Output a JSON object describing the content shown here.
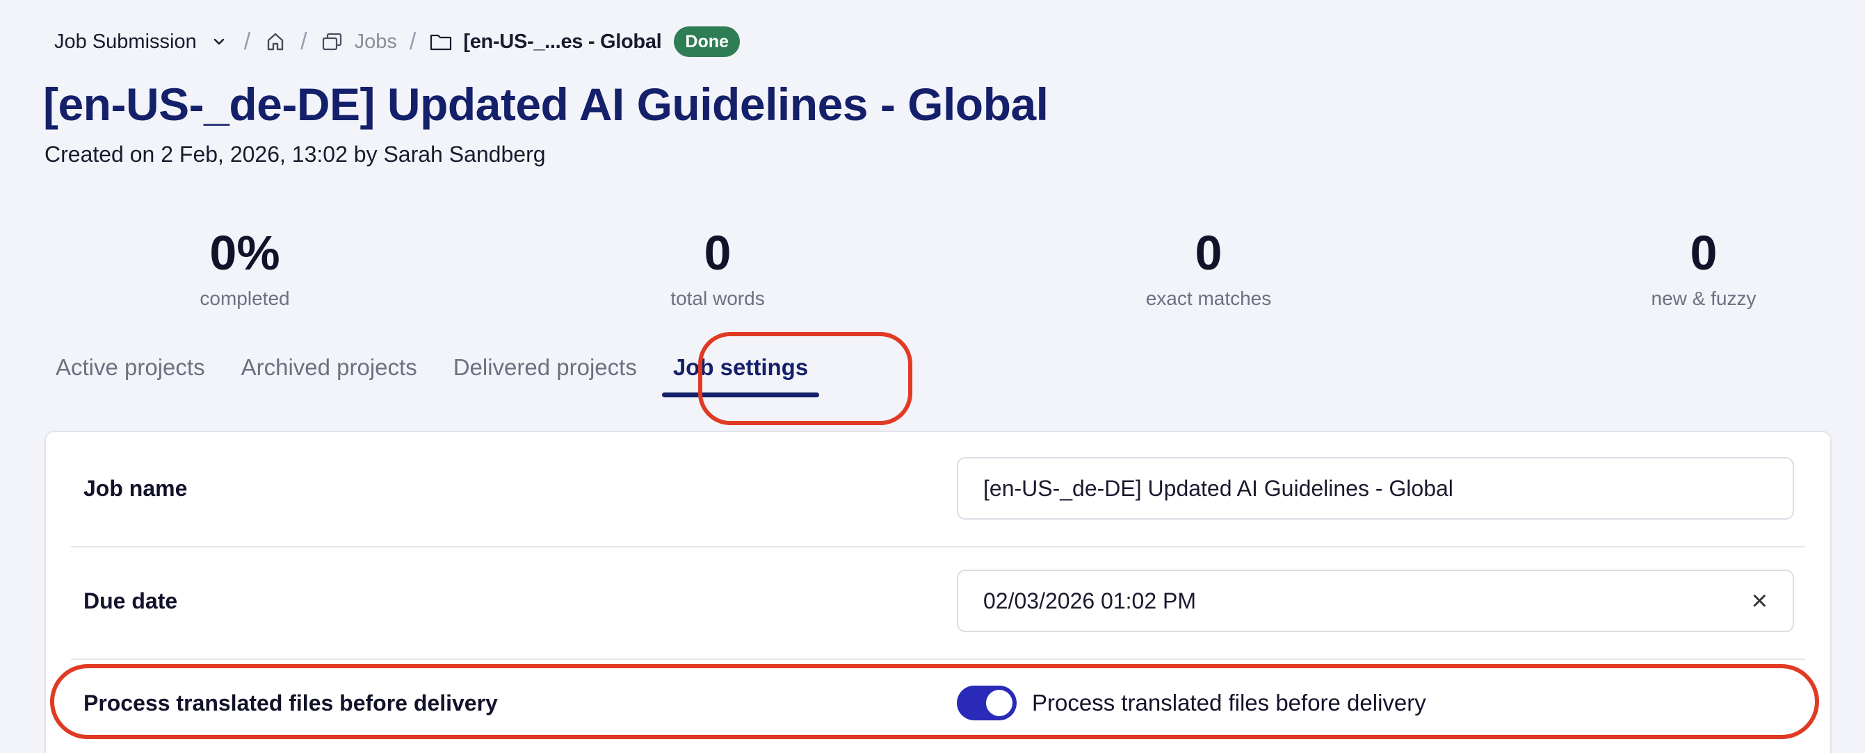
{
  "breadcrumb": {
    "dropdown_label": "Job Submission",
    "jobs_label": "Jobs",
    "current_label": "[en-US-_...es - Global",
    "status_badge": "Done"
  },
  "page": {
    "title": "[en-US-_de-DE] Updated AI Guidelines - Global",
    "subtitle": "Created on 2 Feb, 2026, 13:02 by Sarah Sandberg"
  },
  "stats": [
    {
      "value": "0%",
      "label": "completed"
    },
    {
      "value": "0",
      "label": "total words"
    },
    {
      "value": "0",
      "label": "exact matches"
    },
    {
      "value": "0",
      "label": "new & fuzzy"
    }
  ],
  "tabs": [
    {
      "label": "Active projects"
    },
    {
      "label": "Archived projects"
    },
    {
      "label": "Delivered projects"
    },
    {
      "label": "Job settings"
    }
  ],
  "settings": {
    "job_name_label": "Job name",
    "job_name_value": "[en-US-_de-DE] Updated AI Guidelines - Global",
    "due_date_label": "Due date",
    "due_date_value": "02/03/2026 01:02 PM",
    "process_label": "Process translated files before delivery",
    "process_toggle_label": "Process translated files before delivery",
    "process_toggle_on": true
  },
  "colors": {
    "title": "#15206b",
    "badge_done": "#2e7d55",
    "highlight": "#e03a24",
    "toggle_on": "#2a2ab8"
  }
}
